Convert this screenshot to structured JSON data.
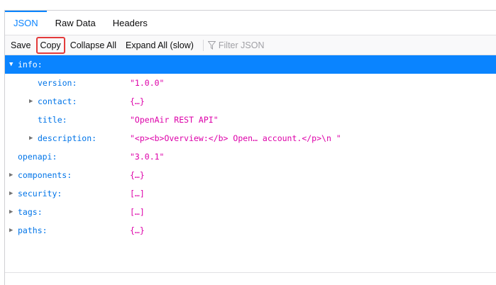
{
  "tabs": [
    {
      "label": "JSON",
      "active": true
    },
    {
      "label": "Raw Data",
      "active": false
    },
    {
      "label": "Headers",
      "active": false
    }
  ],
  "toolbar": {
    "save_label": "Save",
    "copy_label": "Copy",
    "collapse_label": "Collapse All",
    "expand_label": "Expand All (slow)",
    "filter_placeholder": "Filter JSON"
  },
  "tree": {
    "info_key": "info:",
    "version_key": "version:",
    "version_val": "\"1.0.0\"",
    "contact_key": "contact:",
    "contact_val": "{…}",
    "title_key": "title:",
    "title_val": "\"OpenAir REST API\"",
    "description_key": "description:",
    "description_val": "\"<p><b>Overview:</b> Open… account.</p>\\n        \"",
    "openapi_key": "openapi:",
    "openapi_val": "\"3.0.1\"",
    "components_key": "components:",
    "components_val": "{…}",
    "security_key": "security:",
    "security_val": "[…]",
    "tags_key": "tags:",
    "tags_val": "[…]",
    "paths_key": "paths:",
    "paths_val": "{…}"
  },
  "colors": {
    "accent": "#0a84ff",
    "key": "#0074e8",
    "string": "#dd00a9",
    "highlight_border": "#e33b3b"
  }
}
